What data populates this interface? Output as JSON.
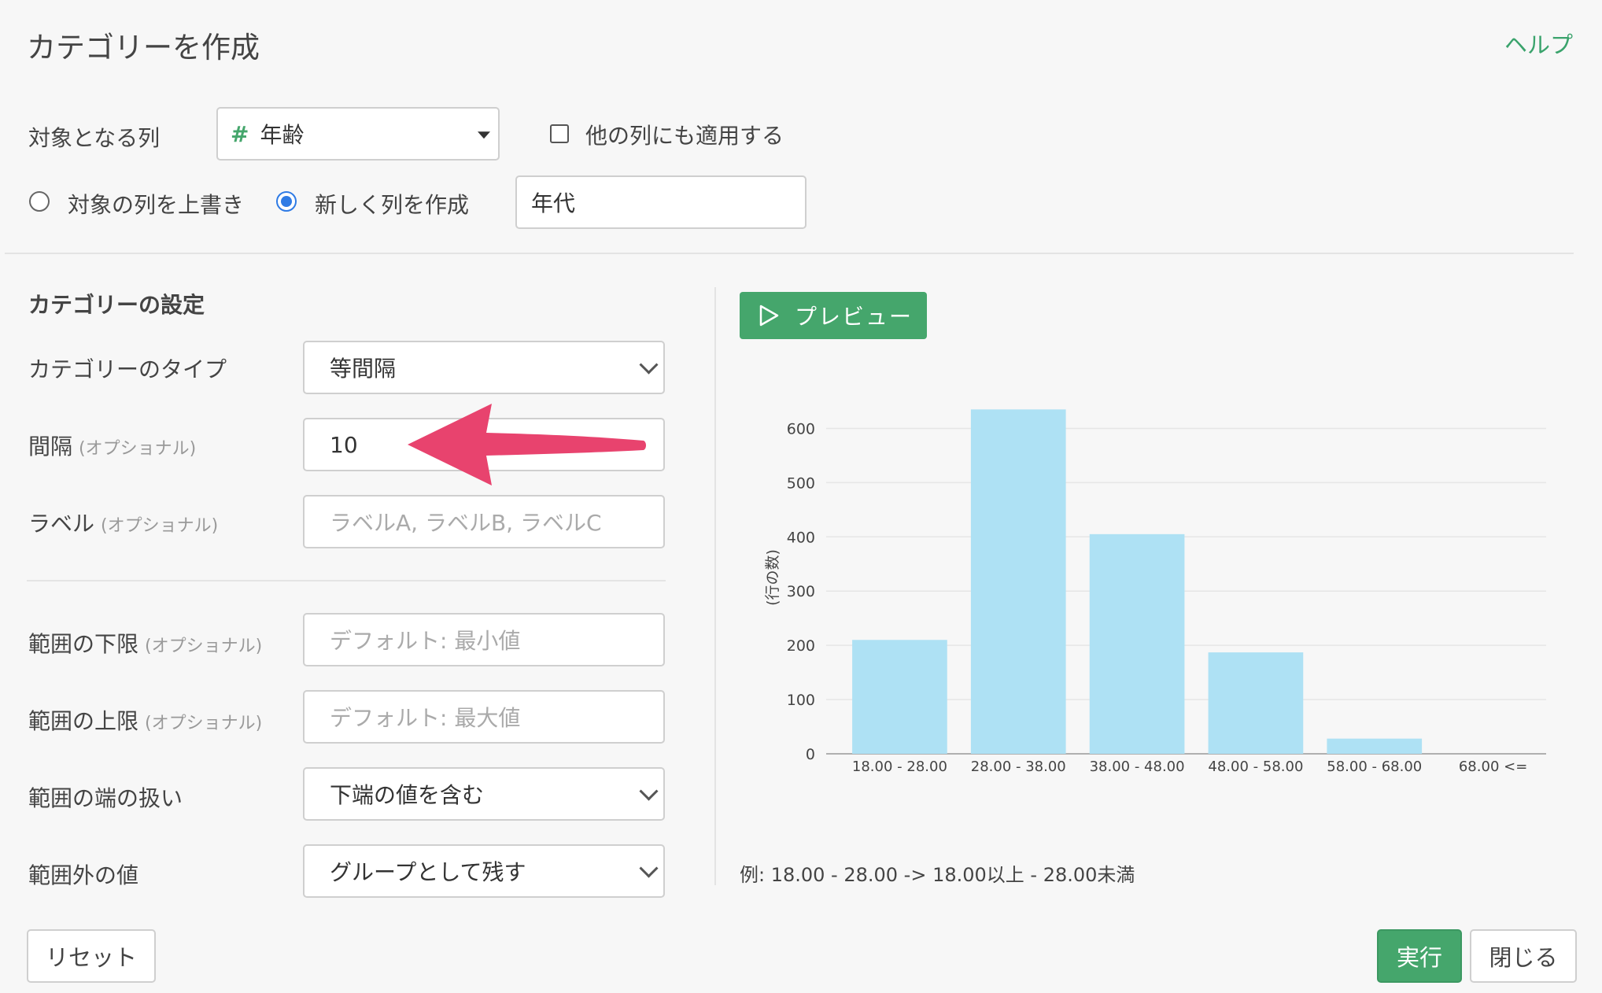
{
  "header": {
    "title": "カテゴリーを作成",
    "help": "ヘルプ"
  },
  "target": {
    "label": "対象となる列",
    "column_icon": "#",
    "column_value": "年齢",
    "apply_others_label": "他の列にも適用する"
  },
  "mode": {
    "overwrite_label": "対象の列を上書き",
    "new_label": "新しく列を作成",
    "selected": "new",
    "new_column_value": "年代"
  },
  "settings": {
    "title": "カテゴリーの設定",
    "type_label": "カテゴリーのタイプ",
    "type_value": "等間隔",
    "interval_label": "間隔",
    "optional": "(オプショナル)",
    "interval_value": "10",
    "labels_label": "ラベル",
    "labels_placeholder": "ラベルA, ラベルB, ラベルC",
    "lower_label": "範囲の下限",
    "lower_placeholder": "デフォルト: 最小値",
    "upper_label": "範囲の上限",
    "upper_placeholder": "デフォルト: 最大値",
    "edge_label": "範囲の端の扱い",
    "edge_value": "下端の値を含む",
    "outside_label": "範囲外の値",
    "outside_value": "グループとして残す"
  },
  "preview": {
    "button_label": "プレビュー",
    "example": "例: 18.00 - 28.00 -> 18.00以上 - 28.00未満"
  },
  "footer": {
    "reset": "リセット",
    "run": "実行",
    "close": "閉じる"
  },
  "colors": {
    "accent": "#45a66c",
    "bar": "#aee1f4",
    "arrow": "#e8436e",
    "radio": "#2f7be5"
  },
  "chart_data": {
    "type": "bar",
    "categories": [
      "18.00 - 28.00",
      "28.00 - 38.00",
      "38.00 - 48.00",
      "48.00 - 58.00",
      "58.00 - 68.00",
      "68.00 <="
    ],
    "values": [
      210,
      635,
      405,
      187,
      28,
      0
    ],
    "ylabel": "(行の数)",
    "yticks": [
      0,
      100,
      200,
      300,
      400,
      500,
      600
    ],
    "ylim": [
      0,
      650
    ],
    "grid": true
  }
}
